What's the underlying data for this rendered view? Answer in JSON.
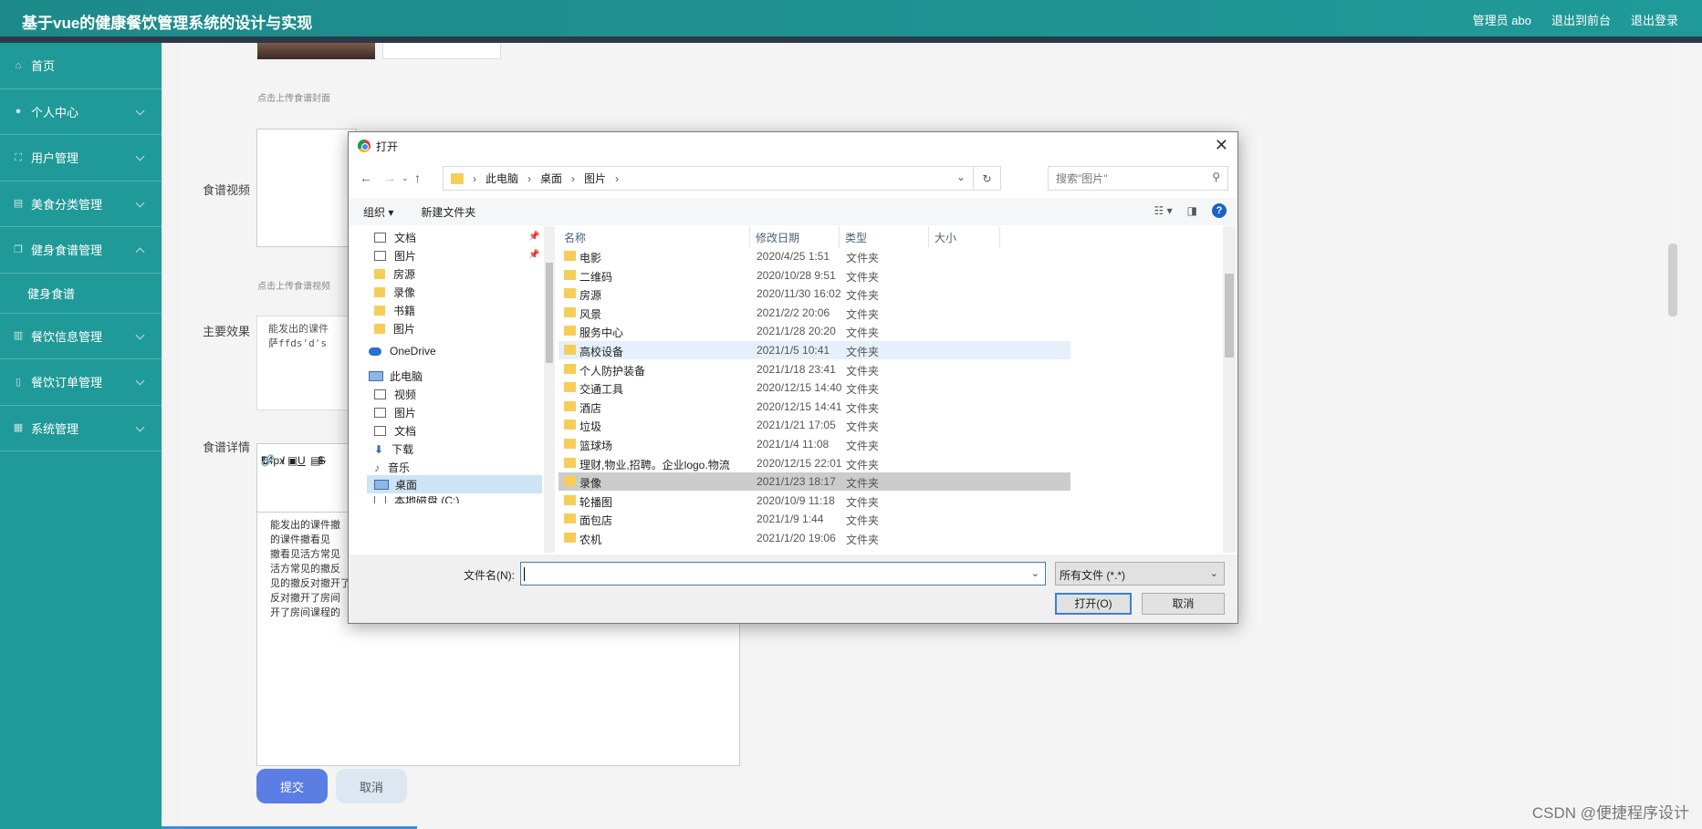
{
  "header": {
    "title": "基于vue的健康餐饮管理系统的设计与实现",
    "user": "管理员 abo",
    "front": "退出到前台",
    "logout": "退出登录"
  },
  "sidebar": {
    "items": [
      {
        "label": "首页",
        "icon": "home-icon"
      },
      {
        "label": "个人中心",
        "icon": "user-icon"
      },
      {
        "label": "用户管理",
        "icon": "users-icon"
      },
      {
        "label": "美食分类管理",
        "icon": "category-icon"
      },
      {
        "label": "健身食谱管理",
        "icon": "recipe-icon"
      },
      {
        "label": "健身食谱",
        "icon": ""
      },
      {
        "label": "餐饮信息管理",
        "icon": "info-icon"
      },
      {
        "label": "餐饮订单管理",
        "icon": "order-icon"
      },
      {
        "label": "系统管理",
        "icon": "system-icon"
      }
    ]
  },
  "form": {
    "cover_hint": "点击上传食谱封面",
    "video_label": "食谱视频",
    "video_hint": "点击上传食谱视频",
    "effect_label": "主要效果",
    "effect_text_1": "能发出的课件",
    "effect_text_2": "萨ffds'd's",
    "detail_label": "食谱详情",
    "font_size": "14px",
    "detail_lines": [
      "能发出的课件撤",
      "的课件撤看见",
      "撤看见活方常见",
      "活方常见的撤反",
      "见的撤反对撤开了",
      "反对撤开了房间",
      "开了房间课程的"
    ],
    "submit": "提交",
    "cancel": "取消"
  },
  "dialog": {
    "title": "打开",
    "breadcrumb": [
      "此电脑",
      "桌面",
      "图片"
    ],
    "search_placeholder": "搜索\"图片\"",
    "organize": "组织 ▾",
    "new_folder": "新建文件夹",
    "nav_items": [
      {
        "label": "文档",
        "icon": "document-icon",
        "pinned": true
      },
      {
        "label": "图片",
        "icon": "pictures-icon",
        "pinned": true
      },
      {
        "label": "房源",
        "icon": "folder-icon"
      },
      {
        "label": "录像",
        "icon": "folder-icon"
      },
      {
        "label": "书籍",
        "icon": "folder-icon"
      },
      {
        "label": "图片",
        "icon": "folder-icon"
      },
      {
        "label": "OneDrive",
        "icon": "onedrive-icon"
      },
      {
        "label": "此电脑",
        "icon": "pc-icon"
      },
      {
        "label": "视频",
        "icon": "video-icon"
      },
      {
        "label": "图片",
        "icon": "pictures-icon"
      },
      {
        "label": "文档",
        "icon": "document-icon"
      },
      {
        "label": "下载",
        "icon": "download-icon"
      },
      {
        "label": "音乐",
        "icon": "music-icon"
      },
      {
        "label": "桌面",
        "icon": "desktop-icon"
      },
      {
        "label": "本地磁盘 (C:)",
        "icon": "disk-icon"
      }
    ],
    "columns": [
      "名称",
      "修改日期",
      "类型",
      "大小"
    ],
    "files": [
      {
        "name": "电影",
        "date": "2020/4/25 1:51",
        "type": "文件夹"
      },
      {
        "name": "二维码",
        "date": "2020/10/28 9:51",
        "type": "文件夹"
      },
      {
        "name": "房源",
        "date": "2020/11/30 16:02",
        "type": "文件夹"
      },
      {
        "name": "风景",
        "date": "2021/2/2 20:06",
        "type": "文件夹"
      },
      {
        "name": "服务中心",
        "date": "2021/1/28 20:20",
        "type": "文件夹"
      },
      {
        "name": "高校设备",
        "date": "2021/1/5 10:41",
        "type": "文件夹"
      },
      {
        "name": "个人防护装备",
        "date": "2021/1/18 23:41",
        "type": "文件夹"
      },
      {
        "name": "交通工具",
        "date": "2020/12/15 14:40",
        "type": "文件夹"
      },
      {
        "name": "酒店",
        "date": "2020/12/15 14:41",
        "type": "文件夹"
      },
      {
        "name": "垃圾",
        "date": "2021/1/21 17:05",
        "type": "文件夹"
      },
      {
        "name": "篮球场",
        "date": "2021/1/4 11:08",
        "type": "文件夹"
      },
      {
        "name": "理财,物业,招聘。企业logo.物流",
        "date": "2020/12/15 22:01",
        "type": "文件夹"
      },
      {
        "name": "录像",
        "date": "2021/1/23 18:17",
        "type": "文件夹"
      },
      {
        "name": "轮播图",
        "date": "2020/10/9 11:18",
        "type": "文件夹"
      },
      {
        "name": "面包店",
        "date": "2021/1/9 1:44",
        "type": "文件夹"
      },
      {
        "name": "农机",
        "date": "2021/1/20 19:06",
        "type": "文件夹"
      }
    ],
    "filename_label": "文件名(N):",
    "filename_value": "",
    "filter": "所有文件 (*.*)",
    "open": "打开(O)",
    "cancel": "取消"
  },
  "watermark": "CSDN @便捷程序设计"
}
